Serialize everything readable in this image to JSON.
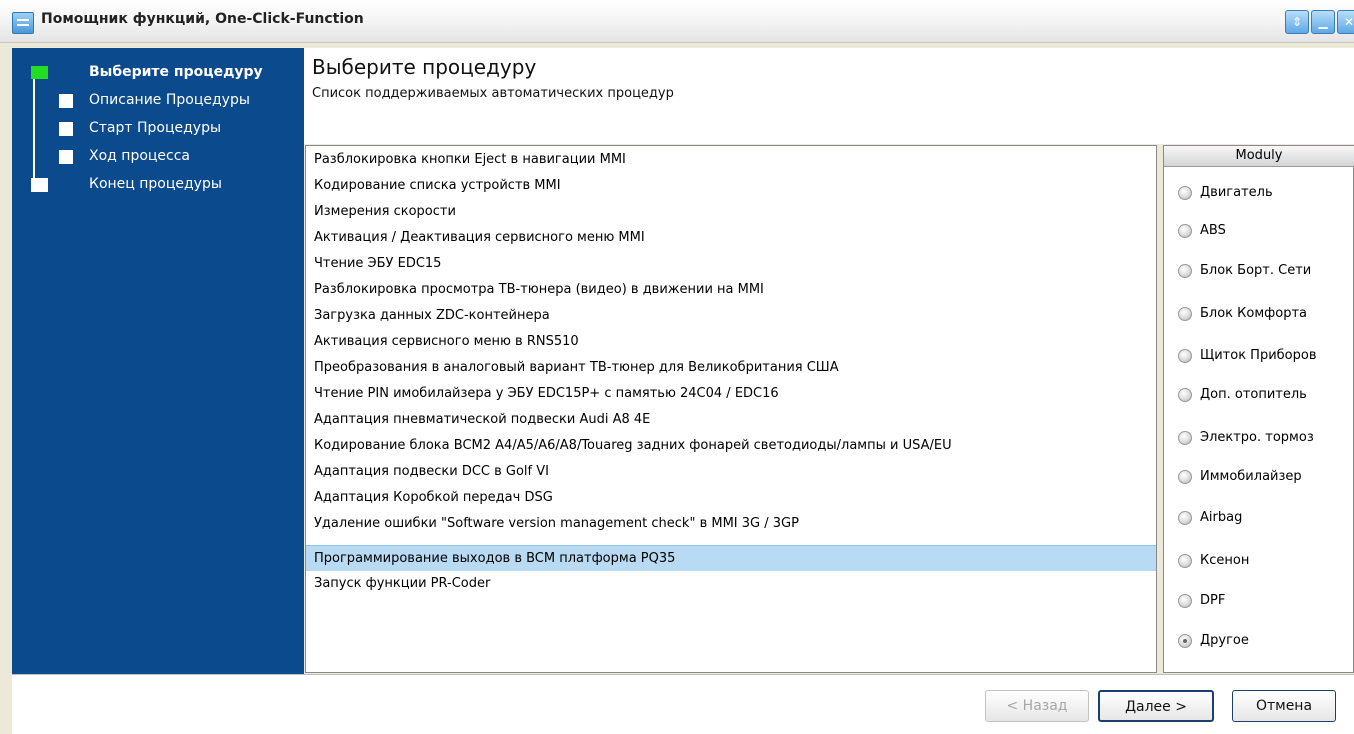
{
  "window": {
    "title": "Помощник функций, One-Click-Function"
  },
  "sidebar": {
    "steps": [
      {
        "label": "Выберите процедуру",
        "active": true
      },
      {
        "label": "Описание Процедуры"
      },
      {
        "label": "Старт Процедуры"
      },
      {
        "label": "Ход процесса"
      },
      {
        "label": "Конец процедуры"
      }
    ]
  },
  "main": {
    "title": "Выберите процедуру",
    "subtitle": "Список поддерживаемых автоматических процедур",
    "procedures": [
      "Разблокировка кнопки Eject в навигации MMI",
      "Кодирование списка устройств MMI",
      "Измерения скорости",
      "Активация / Деактивация сервисного меню MMI",
      "Чтение ЭБУ EDC15",
      "Разблокировка просмотра ТВ-тюнера  (видео) в движении на MMI",
      "Загрузка данных ZDC-контейнера",
      "Активация сервисного меню в RNS510",
      "Преобразования в аналоговый вариант ТВ-тюнер для Великобритания США",
      "Чтение PIN имобилайзера у ЭБУ EDC15P+ с памятью 24C04 / EDC16",
      "Адаптация пневматической подвески Audi A8 4E",
      "Кодирование блока  BCM2 A4/A5/A6/A8/Touareg  задних фонарей светодиоды/лампы и  USA/EU",
      "Адаптация подвески DCC в Golf VI",
      "Адаптация Коробкой передач DSG",
      "Удаление ошибки  \"Software version management check\"  в MMI 3G / 3GP",
      "Программирование выходов в BCM платформа PQ35",
      "Запуск функции PR-Coder"
    ],
    "selected_index": 15
  },
  "moduly": {
    "header": "Moduly",
    "options": [
      "Двигатель",
      "ABS",
      "Блок Борт. Сети",
      "Блок Комфорта",
      "Щиток Приборов",
      "Доп. отопитель",
      "Электро. тормоз",
      "Иммобилайзер",
      "Airbag",
      "Ксенон",
      "DPF",
      "Другое"
    ],
    "selected": "Другое"
  },
  "footer": {
    "back_label": "< Назад",
    "next_label": "Далее >",
    "cancel_label": "Отмена"
  }
}
